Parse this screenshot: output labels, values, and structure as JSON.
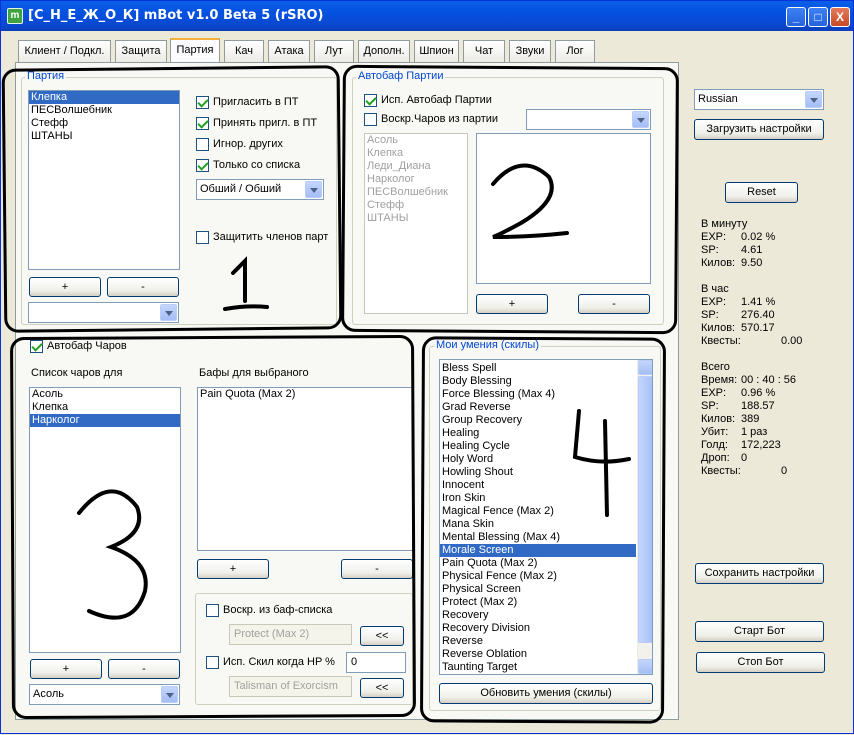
{
  "window": {
    "title": "[С_Н_Е_Ж_О_К] mBot v1.0 Beta 5 (rSRO)",
    "icon_glyph": "m",
    "min_glyph": "_",
    "max_glyph": "□",
    "close_glyph": "X"
  },
  "tabs": [
    "Клиент / Подкл.",
    "Защита",
    "Партия",
    "Кач",
    "Атака",
    "Лут",
    "Дополн.",
    "Шпион",
    "Чат",
    "Звуки",
    "Лог"
  ],
  "party": {
    "label": "Партия",
    "members": [
      "Клепка",
      "ПЕСВолшебник",
      "Стефф",
      "ШТАНЫ"
    ],
    "invite": "Пригласить в ПТ",
    "accept": "Принять пригл. в ПТ",
    "ignore": "Игнор. других",
    "only_list": "Только со списка",
    "share_mode": "Обший / Обший",
    "protect": "Защитить членов парт",
    "add": "+",
    "remove": "-",
    "bottom_combo": ""
  },
  "autobuff": {
    "label": "Автобаф Партии",
    "use": "Исп. Автобаф Партии",
    "resurrect": "Воскр.Чаров из партии",
    "combo": "",
    "chars": [
      "Асоль",
      "Клепка",
      "Леди_Диана",
      "Нарколог",
      "ПЕСВолшебник",
      "Стефф",
      "ШТАНЫ"
    ],
    "add": "+",
    "remove": "-"
  },
  "charbuff": {
    "auto": "Автобаф Чаров",
    "list_label": "Список чаров для",
    "buffs_label": "Бафы для выбраного",
    "chars": [
      "Асоль",
      "Клепка",
      "Нарколог"
    ],
    "buffs": [
      "Pain Quota (Max 2)"
    ],
    "add": "+",
    "remove": "-",
    "resurrect": "Воскр. из баф-списка",
    "resurrect_skill": "Protect (Max 2)",
    "use_hp": "Исп. Скил когда HP %",
    "hp_value": "0",
    "hp_skill": "Talisman of Exorcism",
    "move": "<<",
    "char_combo": "Асоль"
  },
  "skills": {
    "label": "Мои умения (скилы)",
    "items": [
      "Bless Spell",
      "Body Blessing",
      "Force Blessing (Max 4)",
      "Grad Reverse",
      "Group Recovery",
      "Healing",
      "Healing Cycle",
      "Holy Word",
      "Howling Shout",
      "Innocent",
      "Iron Skin",
      "Magical Fence (Max 2)",
      "Mana Skin",
      "Mental Blessing (Max 4)",
      "Morale Screen",
      "Pain Quota (Max 2)",
      "Physical Fence (Max 2)",
      "Physical Screen",
      "Protect (Max 2)",
      "Recovery",
      "Recovery Division",
      "Reverse",
      "Reverse Oblation",
      "Taunting Target"
    ],
    "update": "Обновить умения (скилы)"
  },
  "right": {
    "language": "Russian",
    "load": "Загрузить настройки",
    "reset": "Reset",
    "per_min": {
      "title": "В минуту",
      "rows": [
        [
          "EXP:",
          "0.02 %"
        ],
        [
          "SP:",
          "4.61"
        ],
        [
          "Килов:",
          "9.50"
        ]
      ]
    },
    "per_hour": {
      "title": "В час",
      "rows": [
        [
          "EXP:",
          "1.41 %"
        ],
        [
          "SP:",
          "276.40"
        ],
        [
          "Килов:",
          "570.17"
        ],
        [
          "Квесты:",
          "0.00"
        ]
      ]
    },
    "total": {
      "title": "Всего",
      "rows": [
        [
          "Время:",
          "00 : 40 : 56"
        ],
        [
          "EXP:",
          "0.96 %"
        ],
        [
          "SP:",
          "188.57"
        ],
        [
          "Килов:",
          "389"
        ],
        [
          "Убит:",
          "1 раз"
        ],
        [
          "Голд:",
          "172,223"
        ],
        [
          "Дроп:",
          "0"
        ],
        [
          "Квесты:",
          "0"
        ]
      ]
    },
    "save": "Сохранить настройки",
    "start": "Старт Бот",
    "stop": "Стоп Бот"
  }
}
